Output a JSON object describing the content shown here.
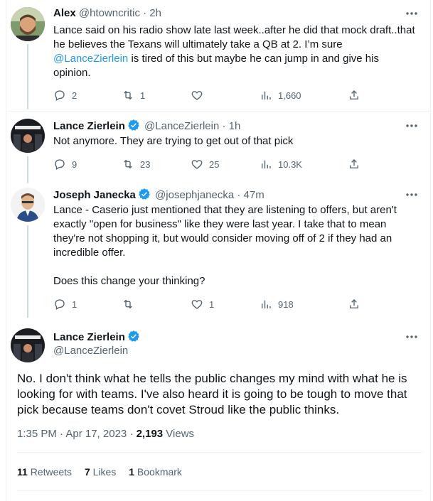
{
  "tweets": [
    {
      "name": "Alex",
      "handle": "@htowncritic",
      "time": "· 2h",
      "text_before": "Lance said on his radio show late last week..after he did that mock draft..that he believes the Texans will ultimately take a QB at 2. I’m sure ",
      "mention": "@LanceZierlein",
      "text_after": " is tired of this but maybe he can jump in and give his opinion.",
      "replies": "2",
      "retweets": "1",
      "likes": "",
      "views": "1,660"
    },
    {
      "name": "Lance Zierlein",
      "handle": "@LanceZierlein",
      "time": "· 1h",
      "text": "Not anymore. They are trying to get out of that pick",
      "replies": "9",
      "retweets": "23",
      "likes": "25",
      "views": "10.3K"
    },
    {
      "name": "Joseph Janecka",
      "handle": "@josephjanecka",
      "time": "· 47m",
      "text1": "Lance - Caserio just mentioned that they are listening to offers, but aren't exactly \"open for business\" like they were last year.  I take that to mean they're not shopping it, but would consider moving off of 2 if they had an incredible offer.",
      "text2": "Does this change your thinking?",
      "replies": "1",
      "retweets": "",
      "likes": "1",
      "views": "918"
    }
  ],
  "main": {
    "name": "Lance Zierlein",
    "handle": "@LanceZierlein",
    "text": "No. I don't think what he tells the public changes my mind with what he is looking for with teams. I've also heard it is going to be tough to move that pick because teams don't covet Stroud like the public thinks.",
    "time": "1:35 PM · Apr 17, 2023 · ",
    "views_count": "2,193",
    "views_label": " Views",
    "retweets_count": "11",
    "retweets_label": " Retweets",
    "likes_count": "7",
    "likes_label": " Likes",
    "bookmarks_count": "1",
    "bookmarks_label": " Bookmark"
  },
  "colors": {
    "accent": "#1d9bf0",
    "text": "#0f1419",
    "secondary": "#536471"
  },
  "icons": [
    "reply-icon",
    "retweet-icon",
    "like-icon",
    "views-icon",
    "share-icon",
    "more-icon",
    "verified-badge-icon"
  ]
}
